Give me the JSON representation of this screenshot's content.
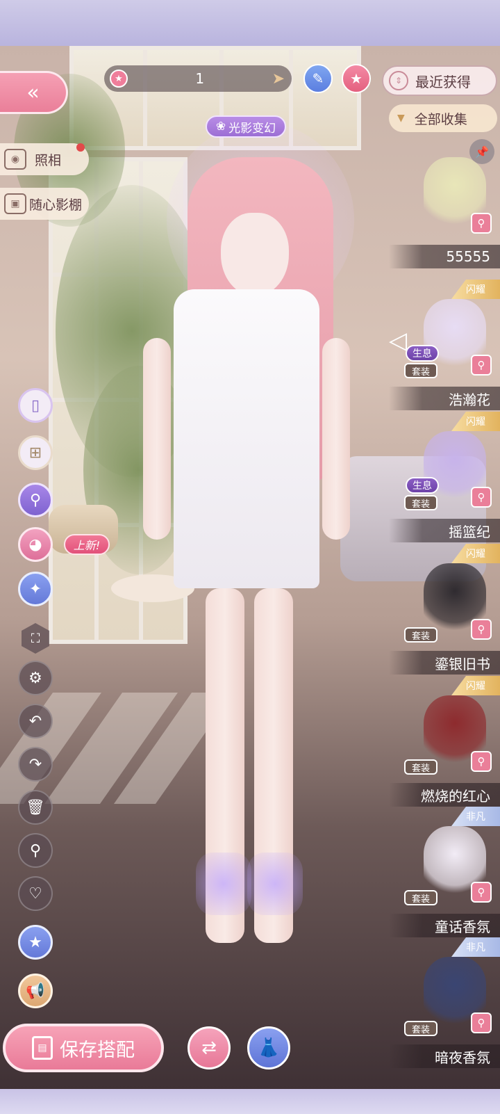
{
  "top_bar": {
    "page_number": "1",
    "sort_label": "最近获得",
    "filter_label": "全部收集"
  },
  "badge": {
    "effect_label": "光影变幻"
  },
  "side_tags": {
    "photo_label": "照相",
    "studio_label": "随心影棚"
  },
  "left_tools": {
    "new_label": "上新!"
  },
  "bottom": {
    "save_label": "保存搭配"
  },
  "items": [
    {
      "name": "55555",
      "tags": [],
      "rank": "",
      "garment_color": "#e8e6b8"
    },
    {
      "name": "浩瀚花",
      "tags": [
        "生息",
        "套装"
      ],
      "rank": "闪耀",
      "garment_color": "#e7dcf4"
    },
    {
      "name": "摇篮纪",
      "tags": [
        "生息",
        "套装"
      ],
      "rank": "闪耀",
      "garment_color": "#c7b3ea"
    },
    {
      "name": "鎏银旧书",
      "tags": [
        "套装"
      ],
      "rank": "闪耀",
      "garment_color": "#2f2b30"
    },
    {
      "name": "燃烧的红心",
      "tags": [
        "套装"
      ],
      "rank": "闪耀",
      "garment_color": "#8e2b2e"
    },
    {
      "name": "童话香氛",
      "tags": [
        "套装"
      ],
      "rank": "非凡",
      "garment_color": "#f2ecf6"
    },
    {
      "name": "暗夜香氛",
      "tags": [
        "套装"
      ],
      "rank": "非凡",
      "garment_color": "#3a4572"
    }
  ],
  "colors": {
    "accent_pink": "#ea7f99",
    "accent_purple": "#9c6ed4",
    "gold": "#e8c79a"
  }
}
